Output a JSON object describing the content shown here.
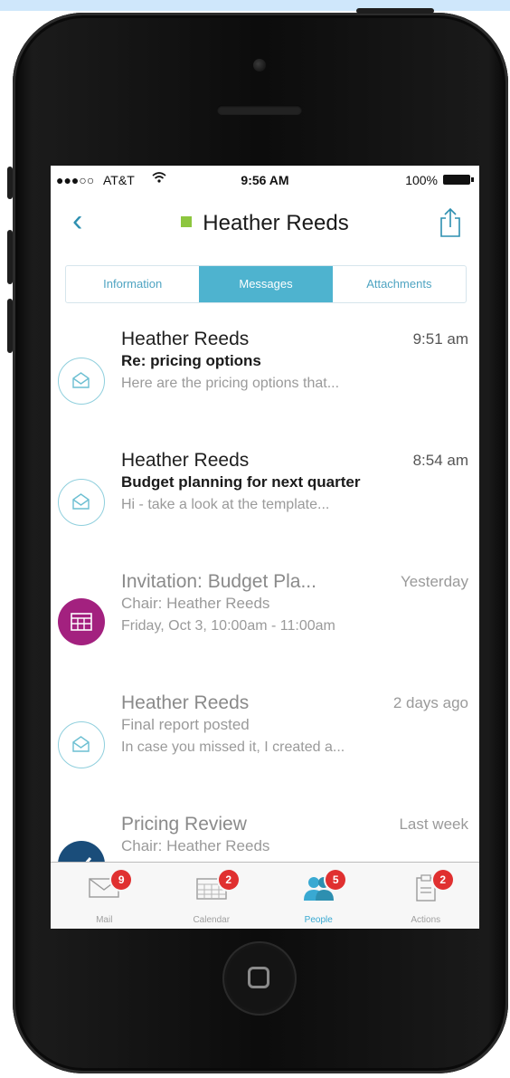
{
  "status_bar": {
    "signal": "●●●○○",
    "carrier": "AT&T",
    "time": "9:56 AM",
    "battery": "100%"
  },
  "nav": {
    "title": "Heather Reeds",
    "presence_color": "#8dc63f"
  },
  "tabs": [
    {
      "label": "Information",
      "active": false
    },
    {
      "label": "Messages",
      "active": true
    },
    {
      "label": "Attachments",
      "active": false
    }
  ],
  "messages": [
    {
      "type": "mail",
      "sender": "Heather Reeds",
      "time": "9:51 am",
      "subject": "Re: pricing options",
      "preview": "Here are the pricing options that...",
      "unread": true
    },
    {
      "type": "mail",
      "sender": "Heather Reeds",
      "time": "8:54 am",
      "subject": "Budget planning for next quarter",
      "preview": "Hi - take a look at the template...",
      "unread": true
    },
    {
      "type": "calendar",
      "sender": "Invitation: Budget Pla...",
      "time": "Yesterday",
      "subject": "Chair: Heather Reeds",
      "preview": "Friday, Oct 3, 10:00am - 11:00am",
      "unread": false
    },
    {
      "type": "mail",
      "sender": "Heather Reeds",
      "time": "2 days ago",
      "subject": "Final report posted",
      "preview": "In case you missed it, I created a...",
      "unread": false
    },
    {
      "type": "task",
      "sender": "Pricing Review",
      "time": "Last week",
      "subject": "Chair: Heather Reeds",
      "preview": "",
      "unread": false
    }
  ],
  "tabbar": [
    {
      "label": "Mail",
      "badge": "9",
      "icon": "mail-icon",
      "active": false
    },
    {
      "label": "Calendar",
      "badge": "2",
      "icon": "calendar-icon",
      "active": false
    },
    {
      "label": "People",
      "badge": "5",
      "icon": "people-icon",
      "active": true
    },
    {
      "label": "Actions",
      "badge": "2",
      "icon": "clipboard-icon",
      "active": false
    }
  ],
  "colors": {
    "accent": "#4eb3cf",
    "badge": "#e03030",
    "calendar": "#a3217f",
    "task": "#1a4d7a"
  }
}
